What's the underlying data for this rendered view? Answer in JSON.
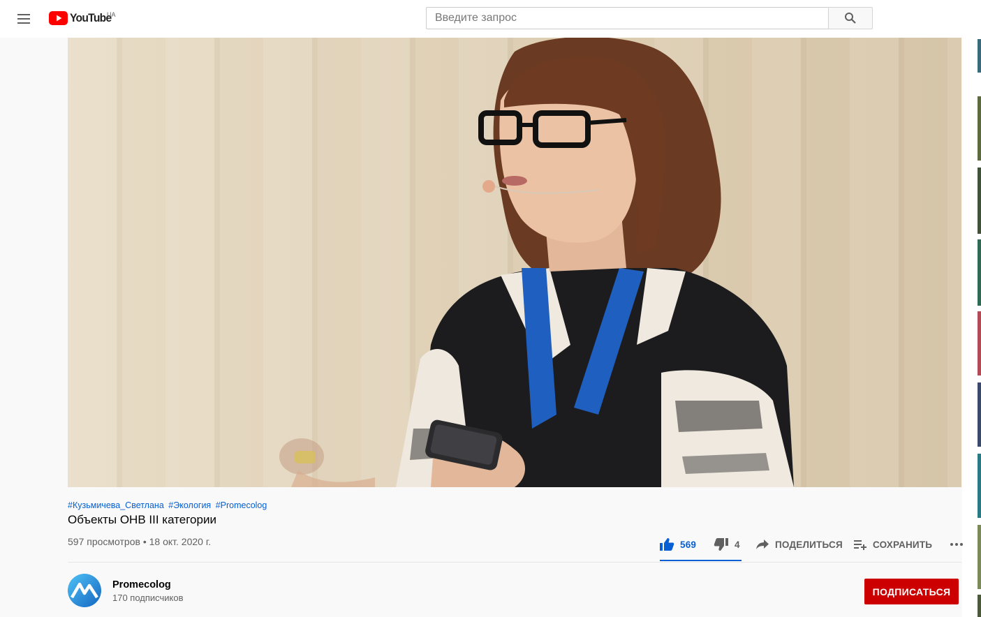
{
  "header": {
    "logo_text": "YouTube",
    "region": "UA",
    "search_placeholder": "Введите запрос"
  },
  "video": {
    "hashtags": [
      "#Кузьмичева_Светлана",
      "#Экология",
      "#Promecolog"
    ],
    "title": "Объекты ОНВ III категории",
    "views": "597 просмотров",
    "date": "18 окт. 2020 г.",
    "stats_separator": "•",
    "likes": "569",
    "dislikes": "4",
    "share_label": "ПОДЕЛИТЬСЯ",
    "save_label": "СОХРАНИТЬ"
  },
  "channel": {
    "name": "Promecolog",
    "subscribers": "170 подписчиков",
    "subscribe_label": "ПОДПИСАТЬСЯ"
  },
  "colors": {
    "brand_red": "#cc0000",
    "link_blue": "#065fd4",
    "youtube_red": "#ff0000"
  }
}
